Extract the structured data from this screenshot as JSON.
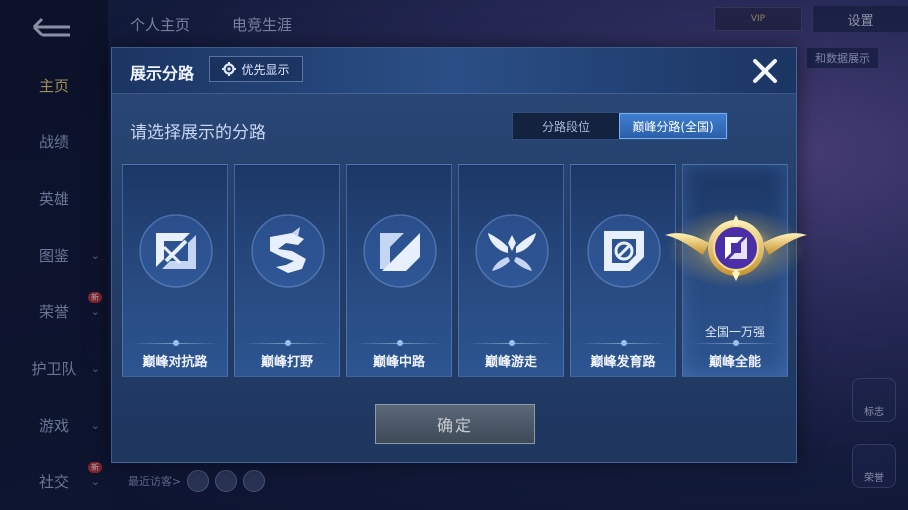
{
  "background": {
    "sidebar": [
      {
        "label": "主页",
        "active": true,
        "chevron": false
      },
      {
        "label": "战绩",
        "active": false,
        "chevron": false
      },
      {
        "label": "英雄",
        "active": false,
        "chevron": false
      },
      {
        "label": "图鉴",
        "active": false,
        "chevron": true
      },
      {
        "label": "荣誉",
        "active": false,
        "chevron": true,
        "badge": "新"
      },
      {
        "label": "护卫队",
        "active": false,
        "chevron": true
      },
      {
        "label": "游戏",
        "active": false,
        "chevron": true
      },
      {
        "label": "社交",
        "active": false,
        "chevron": true,
        "badge": "新"
      }
    ],
    "tabs": [
      "个人主页",
      "电竞生涯"
    ],
    "settings_label": "设置",
    "right_badge_text": "和数据展示",
    "recent_visitors_label": "最近访客>",
    "right_buttons": [
      "标志",
      "荣誉"
    ]
  },
  "modal": {
    "title": "展示分路",
    "priority_label": "优先显示",
    "subtitle": "请选择展示的分路",
    "segments": [
      {
        "label": "分路段位",
        "active": false
      },
      {
        "label": "巅峰分路(全国)",
        "active": true
      }
    ],
    "cards": [
      {
        "label": "巅峰对抗路",
        "icon": "sword-icon",
        "rank": ""
      },
      {
        "label": "巅峰打野",
        "icon": "dragon-icon",
        "rank": ""
      },
      {
        "label": "巅峰中路",
        "icon": "mid-lane-icon",
        "rank": ""
      },
      {
        "label": "巅峰游走",
        "icon": "wings-icon",
        "rank": ""
      },
      {
        "label": "巅峰发育路",
        "icon": "marksman-icon",
        "rank": ""
      },
      {
        "label": "巅峰全能",
        "icon": "gold-allround-emblem-icon",
        "rank": "全国一万强"
      }
    ],
    "confirm_label": "确定"
  },
  "colors": {
    "accent_blue": "#3f7fd1",
    "active_nav": "#f1d27c",
    "gold": "#e9c45a"
  }
}
